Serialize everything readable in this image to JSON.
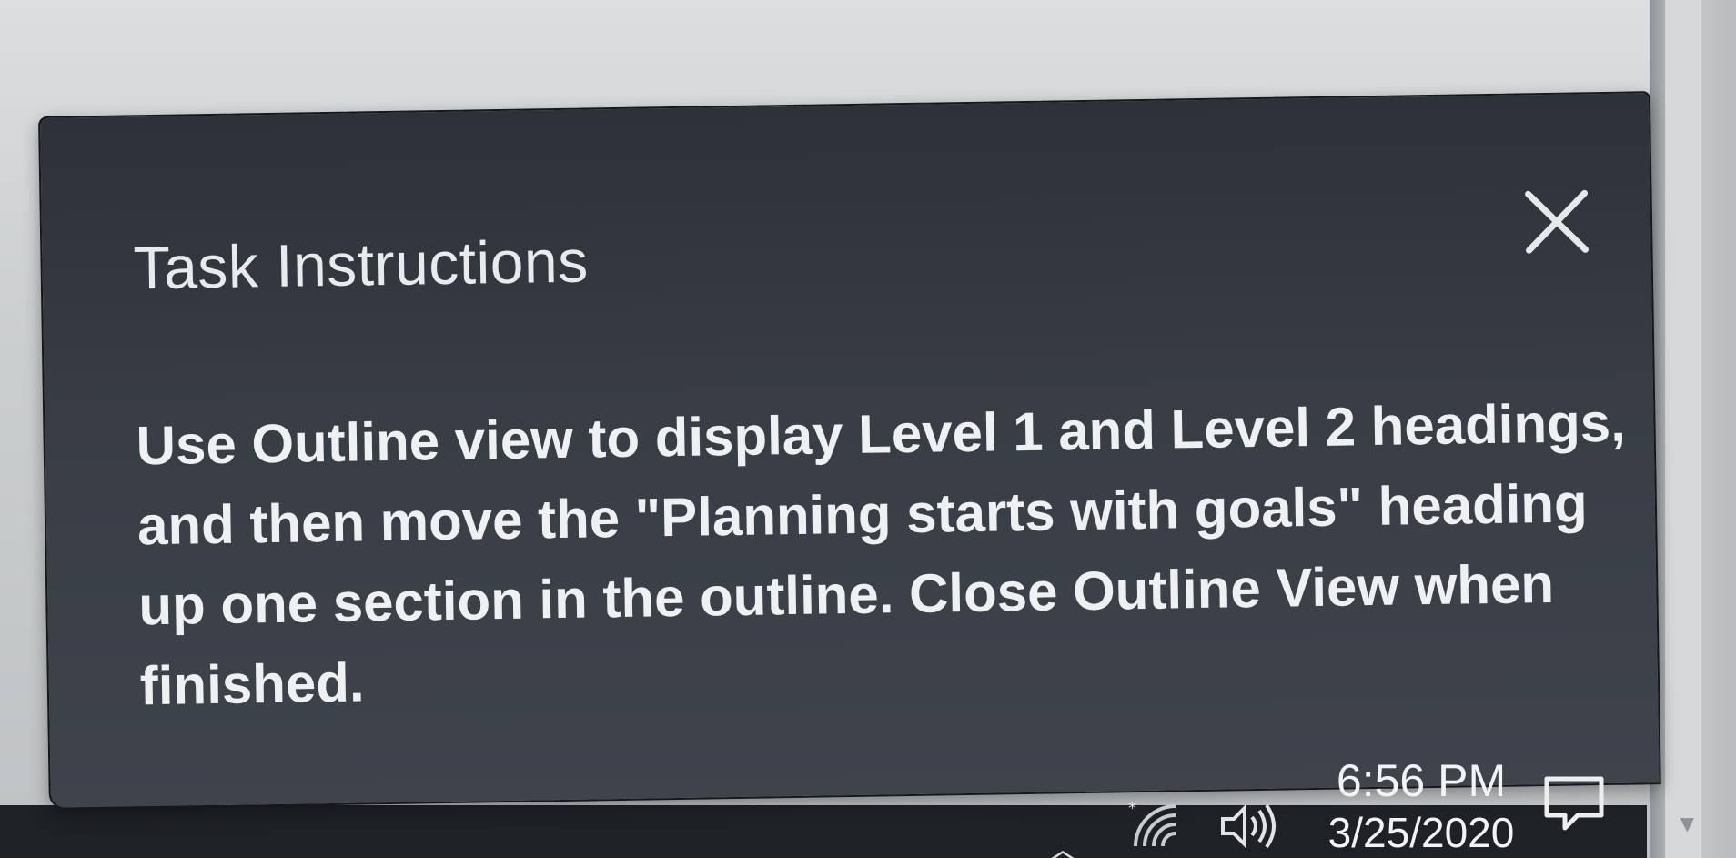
{
  "dialog": {
    "title": "Task Instructions",
    "close_icon": "close-icon",
    "instructions": "Use Outline view to display Level 1 and Level 2 headings, and then move the \"Planning starts with goals\" heading up one section in the outline. Close Outline View when finished."
  },
  "taskbar": {
    "tray_icons": [
      "chevron-up-icon",
      "wifi-icon",
      "volume-icon",
      "notification-icon"
    ],
    "time": "6:56 PM",
    "date": "3/25/2020"
  },
  "colors": {
    "dialog_bg": "#383d46",
    "dialog_text": "#eef0f1",
    "taskbar_bg": "#1e2126",
    "page_bg": "#cfd1d2"
  }
}
